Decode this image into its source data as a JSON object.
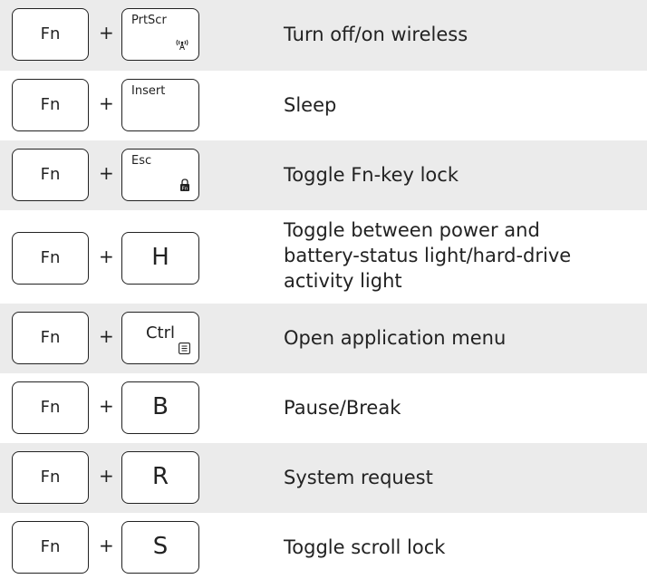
{
  "rows": [
    {
      "fn": "Fn",
      "plus": "+",
      "key": "PrtScr",
      "key_icon": "wireless-icon",
      "desc": "Turn off/on wireless"
    },
    {
      "fn": "Fn",
      "plus": "+",
      "key": "Insert",
      "desc": "Sleep"
    },
    {
      "fn": "Fn",
      "plus": "+",
      "key": "Esc",
      "key_icon": "fn-lock-icon",
      "desc": "Toggle Fn-key lock"
    },
    {
      "fn": "Fn",
      "plus": "+",
      "key": "H",
      "desc_lines": [
        "Toggle between power and",
        "battery-status light/hard-drive",
        "activity light"
      ]
    },
    {
      "fn": "Fn",
      "plus": "+",
      "key": "Ctrl",
      "key_icon": "menu-icon",
      "desc": "Open application menu"
    },
    {
      "fn": "Fn",
      "plus": "+",
      "key": "B",
      "desc": "Pause/Break"
    },
    {
      "fn": "Fn",
      "plus": "+",
      "key": "R",
      "desc": "System request"
    },
    {
      "fn": "Fn",
      "plus": "+",
      "key": "S",
      "desc": "Toggle scroll lock"
    }
  ],
  "colors": {
    "shade": "#ebebeb",
    "ink": "#222222",
    "background": "#ffffff"
  }
}
